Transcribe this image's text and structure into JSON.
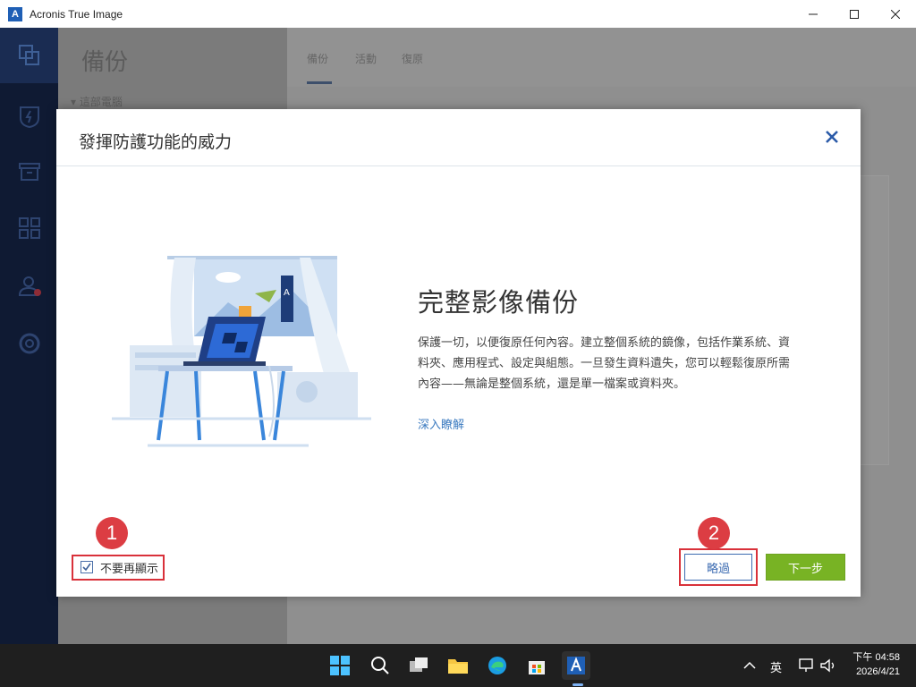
{
  "window": {
    "title": "Acronis True Image",
    "app_icon_letter": "A"
  },
  "background_page": {
    "title": "備份",
    "subtitle": "▾ 這部電腦",
    "tabs": [
      "備份",
      "活動",
      "復原"
    ]
  },
  "modal": {
    "title": "發揮防護功能的威力",
    "feature_title": "完整影像備份",
    "feature_description": "保護一切，以便復原任何內容。建立整個系統的鏡像，包括作業系統、資料夾、應用程式、設定與組態。一旦發生資料遺失，您可以輕鬆復原所需內容——無論是整個系統，還是單一檔案或資料夾。",
    "learn_more": "深入瞭解",
    "dont_show_again": "不要再顯示",
    "dont_show_checked": true,
    "skip_label": "略過",
    "next_label": "下一步"
  },
  "annotations": {
    "badge_1": "1",
    "badge_2": "2",
    "color": "#dc3d43"
  },
  "taskbar": {
    "ime": "英",
    "time": "下午 04:58",
    "date": "2026/4/21"
  },
  "colors": {
    "accent_blue": "#3c6bb1",
    "next_green": "#78b324",
    "sidebar": "#0f1a33"
  }
}
